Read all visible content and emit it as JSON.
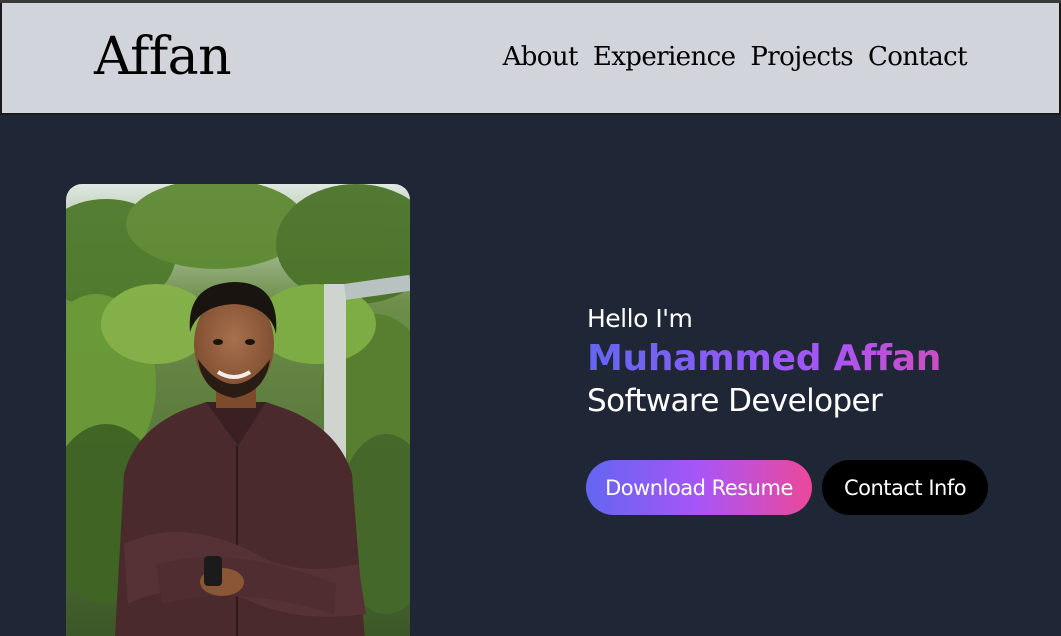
{
  "header": {
    "brand": "Affan",
    "nav": [
      "About",
      "Experience",
      "Projects",
      "Contact"
    ]
  },
  "hero": {
    "greeting": "Hello I'm",
    "name": "Muhammed Affan",
    "role": "Software Developer",
    "primary_button": "Download Resume",
    "secondary_button": "Contact Info"
  },
  "colors": {
    "header_bg": "#d2d4dc",
    "page_bg": "#1f2736",
    "gradient_start": "#6366f1",
    "gradient_mid": "#a855f7",
    "gradient_end": "#ec4899",
    "secondary_button_bg": "#000000"
  }
}
